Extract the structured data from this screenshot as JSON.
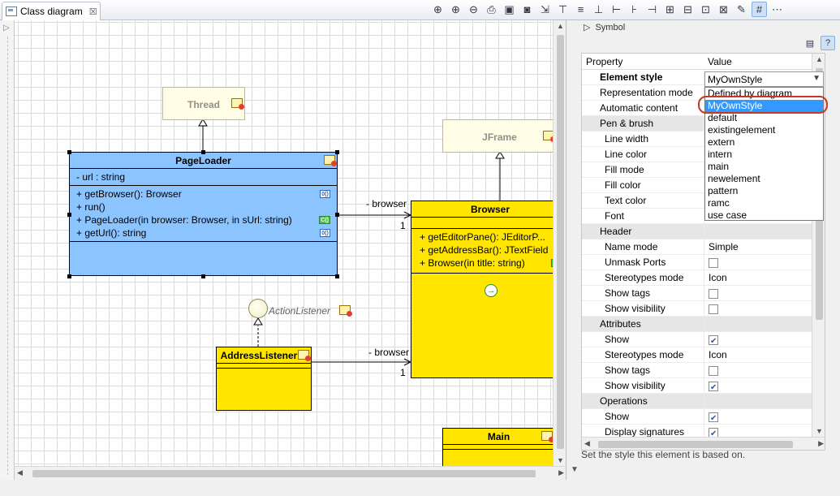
{
  "tab": {
    "title": "Class diagram",
    "close": "☒"
  },
  "toolbar": {
    "icons": [
      "zoom-in-icon",
      "zoom-in-2-icon",
      "zoom-out-icon",
      "print-icon",
      "save-icon",
      "camera-icon",
      "export-icon",
      "align-top-icon",
      "align-middle-icon",
      "align-bottom-icon",
      "align-left-icon",
      "align-center-icon",
      "align-right-icon",
      "distribute-h-icon",
      "distribute-v-icon",
      "fit-icon",
      "fit-width-icon",
      "format-icon",
      "grid-icon",
      "snap-icon"
    ]
  },
  "diagram": {
    "thread": {
      "name": "Thread"
    },
    "jframe": {
      "name": "JFrame"
    },
    "pageloader": {
      "name": "PageLoader",
      "attributes": [
        "- url : string"
      ],
      "operations": [
        {
          "text": "+ getBrowser(): Browser",
          "badge": "0()"
        },
        {
          "text": "+ run()",
          "badge": ""
        },
        {
          "text": "+ PageLoader(in browser: Browser, in sUrl: string)",
          "badge": "C()"
        },
        {
          "text": "+ getUrl(): string",
          "badge": "0()"
        }
      ]
    },
    "browser": {
      "name": "Browser",
      "operations": [
        {
          "text": "+ getEditorPane(): JEditorP...",
          "badge": ""
        },
        {
          "text": "+ getAddressBar(): JTextField",
          "badge": ""
        },
        {
          "text": "+ Browser(in title: string)",
          "badge": "C()"
        }
      ]
    },
    "actionlistener": {
      "name": "ActionListener"
    },
    "addresslistener": {
      "name": "AddressListener"
    },
    "main": {
      "name": "Main"
    },
    "assoc1": {
      "role": "- browser",
      "mult": "1"
    },
    "assoc2": {
      "role": "- browser",
      "mult": "1"
    }
  },
  "panel": {
    "header": "Symbol",
    "columns": {
      "property": "Property",
      "value": "Value"
    },
    "rows": [
      {
        "label": "Element style",
        "value": "MyOwnStyle",
        "kind": "bold"
      },
      {
        "label": "Representation mode",
        "value": "Defined by diagram",
        "kind": "plain"
      },
      {
        "label": "Automatic content",
        "value": "",
        "kind": "plain"
      },
      {
        "label": "Pen & brush",
        "value": "",
        "kind": "group"
      },
      {
        "label": "Line width",
        "value": "",
        "kind": "sub"
      },
      {
        "label": "Line color",
        "value": "",
        "kind": "sub"
      },
      {
        "label": "Fill mode",
        "value": "",
        "kind": "sub"
      },
      {
        "label": "Fill color",
        "value": "",
        "kind": "sub"
      },
      {
        "label": "Text color",
        "value": "",
        "kind": "sub"
      },
      {
        "label": "Font",
        "value": "",
        "kind": "sub"
      },
      {
        "label": "Header",
        "value": "",
        "kind": "group"
      },
      {
        "label": "Name mode",
        "value": "Simple",
        "kind": "sub"
      },
      {
        "label": "Unmask Ports",
        "value": "",
        "kind": "sub",
        "check": false
      },
      {
        "label": "Stereotypes mode",
        "value": "Icon",
        "kind": "sub"
      },
      {
        "label": "Show tags",
        "value": "",
        "kind": "sub",
        "check": false
      },
      {
        "label": "Show visibility",
        "value": "",
        "kind": "sub",
        "check": false
      },
      {
        "label": "Attributes",
        "value": "",
        "kind": "group"
      },
      {
        "label": "Show",
        "value": "",
        "kind": "sub",
        "check": true
      },
      {
        "label": "Stereotypes mode",
        "value": "Icon",
        "kind": "sub"
      },
      {
        "label": "Show tags",
        "value": "",
        "kind": "sub",
        "check": false
      },
      {
        "label": "Show visibility",
        "value": "",
        "kind": "sub",
        "check": true
      },
      {
        "label": "Operations",
        "value": "",
        "kind": "group"
      },
      {
        "label": "Show",
        "value": "",
        "kind": "sub",
        "check": true
      },
      {
        "label": "Display signatures",
        "value": "",
        "kind": "sub",
        "check": true
      }
    ],
    "dropdown": {
      "options": [
        "Defined by diagram",
        "MyOwnStyle",
        "default",
        "existingelement",
        "extern",
        "intern",
        "main",
        "newelement",
        "pattern",
        "ramc",
        "use case"
      ],
      "selected": 1
    },
    "description": "Set the style this element is based on."
  }
}
